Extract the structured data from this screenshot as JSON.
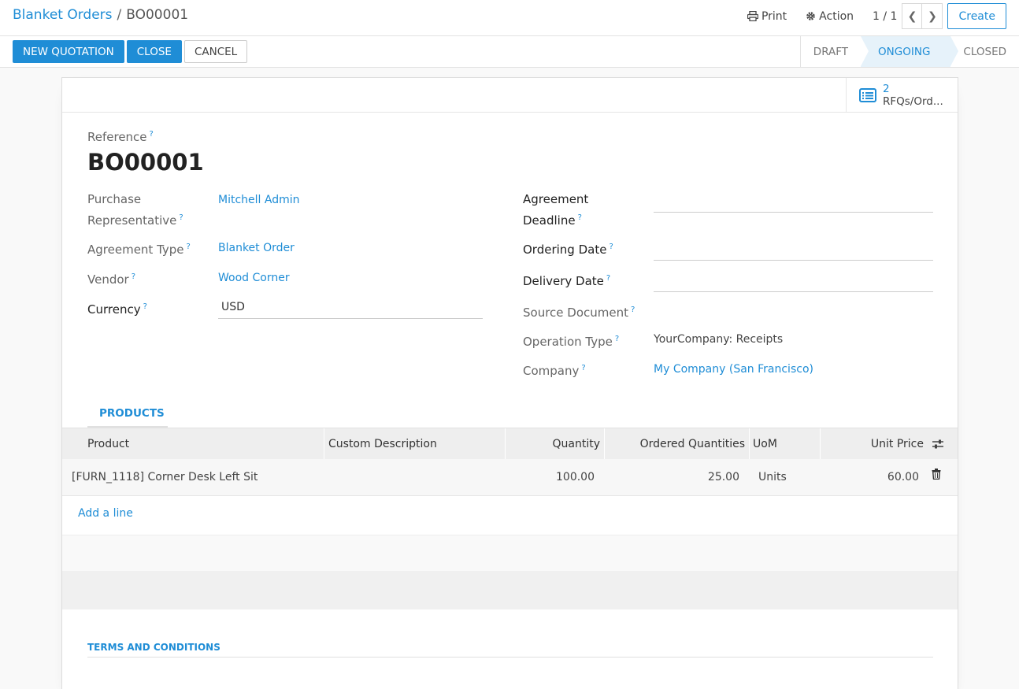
{
  "breadcrumb": {
    "parent": "Blanket Orders",
    "separator": "/",
    "current": "BO00001"
  },
  "control_panel": {
    "print_label": "Print",
    "action_label": "Action",
    "pager": "1 / 1",
    "create_label": "Create"
  },
  "statusbar": {
    "buttons": {
      "new_quotation": "NEW QUOTATION",
      "close": "CLOSE",
      "cancel": "CANCEL"
    },
    "states": {
      "draft": "DRAFT",
      "ongoing": "ONGOING",
      "closed": "CLOSED"
    },
    "active_state": "ONGOING"
  },
  "smart_button": {
    "count": "2",
    "label": "RFQs/Ord..."
  },
  "form": {
    "reference_label": "Reference",
    "reference_value": "BO00001",
    "left": {
      "purchase_rep_label_1": "Purchase",
      "purchase_rep_label_2": "Representative",
      "purchase_rep_value": "Mitchell Admin",
      "agreement_type_label": "Agreement Type",
      "agreement_type_value": "Blanket Order",
      "vendor_label": "Vendor",
      "vendor_value": "Wood Corner",
      "currency_label": "Currency",
      "currency_value": "USD"
    },
    "right": {
      "deadline_label_1": "Agreement",
      "deadline_label_2": "Deadline",
      "ordering_date_label": "Ordering Date",
      "delivery_date_label": "Delivery Date",
      "source_doc_label": "Source Document",
      "operation_type_label": "Operation Type",
      "operation_type_value": "YourCompany: Receipts",
      "company_label": "Company",
      "company_value": "My Company (San Francisco)"
    },
    "help_mark": "?"
  },
  "tabs": {
    "products": "PRODUCTS"
  },
  "table": {
    "headers": {
      "product": "Product",
      "description": "Custom Description",
      "quantity": "Quantity",
      "ordered": "Ordered Quantities",
      "uom": "UoM",
      "unit_price": "Unit Price"
    },
    "rows": [
      {
        "product": "[FURN_1118] Corner Desk Left Sit",
        "description": "",
        "quantity": "100.00",
        "ordered": "25.00",
        "uom": "Units",
        "unit_price": "60.00"
      }
    ],
    "add_line": "Add a line"
  },
  "terms_label": "TERMS AND CONDITIONS",
  "colors": {
    "accent": "#1f8dd6",
    "active_state_bg": "#e6f2fa"
  }
}
